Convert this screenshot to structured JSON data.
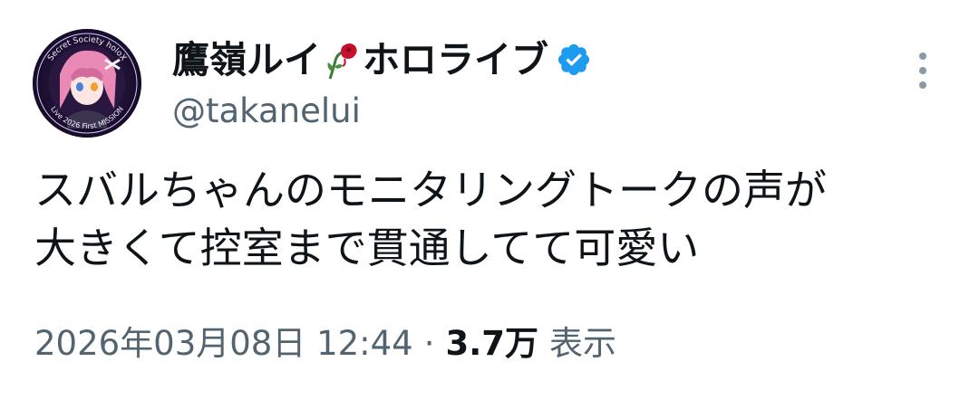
{
  "tweet": {
    "author": {
      "display_name": "鷹嶺ルイ",
      "display_name_suffix": "ホロライブ",
      "emoji_icon": "wilted-rose-icon",
      "verified_icon": "verified-badge-icon",
      "verified_color": "#1d9bf0",
      "handle": "@takanelui",
      "avatar_text": "Secret Society holoX Live 2026 First MISSION"
    },
    "more_icon": "more-vertical-icon",
    "text_lines": [
      "スバルちゃんのモニタリングトークの声が",
      "大きくて控室まで貫通してて可愛い"
    ],
    "timestamp": "2026年03月08日 12:44",
    "separator": "·",
    "views_count": "3.7万",
    "views_label": "表示"
  },
  "colors": {
    "text_primary": "#0f1419",
    "text_secondary": "#536471",
    "accent": "#1d9bf0",
    "rose": "#c8102e"
  }
}
